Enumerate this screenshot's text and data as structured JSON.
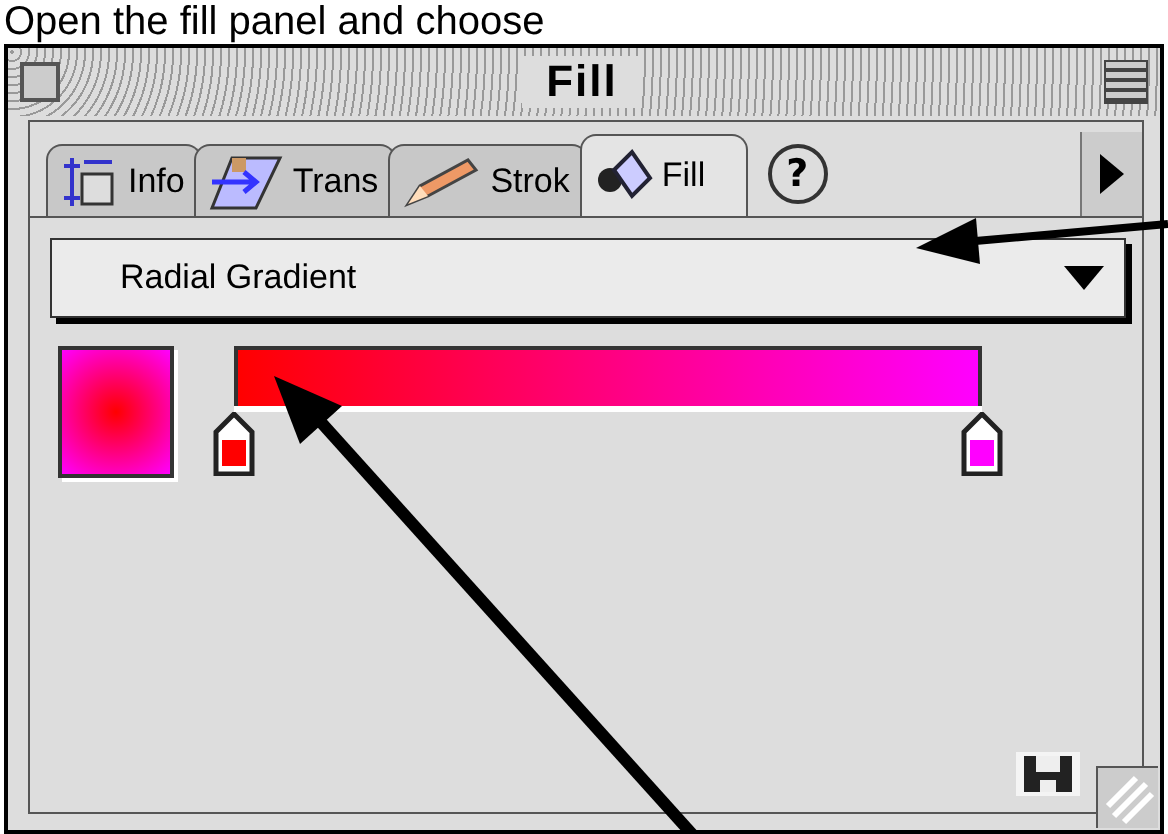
{
  "caption": "Open the fill panel and choose",
  "window": {
    "title": "Fill"
  },
  "tabs": [
    {
      "label": "Info",
      "selected": false
    },
    {
      "label": "Trans",
      "selected": false
    },
    {
      "label": "Strok",
      "selected": false
    },
    {
      "label": "Fill",
      "selected": true
    }
  ],
  "help_button": "?",
  "fill_type": {
    "value": "Radial Gradient"
  },
  "gradient": {
    "stops": [
      {
        "color": "#ff0000",
        "level": 0
      },
      {
        "color": "#ff00ff",
        "level": 1
      }
    ]
  }
}
